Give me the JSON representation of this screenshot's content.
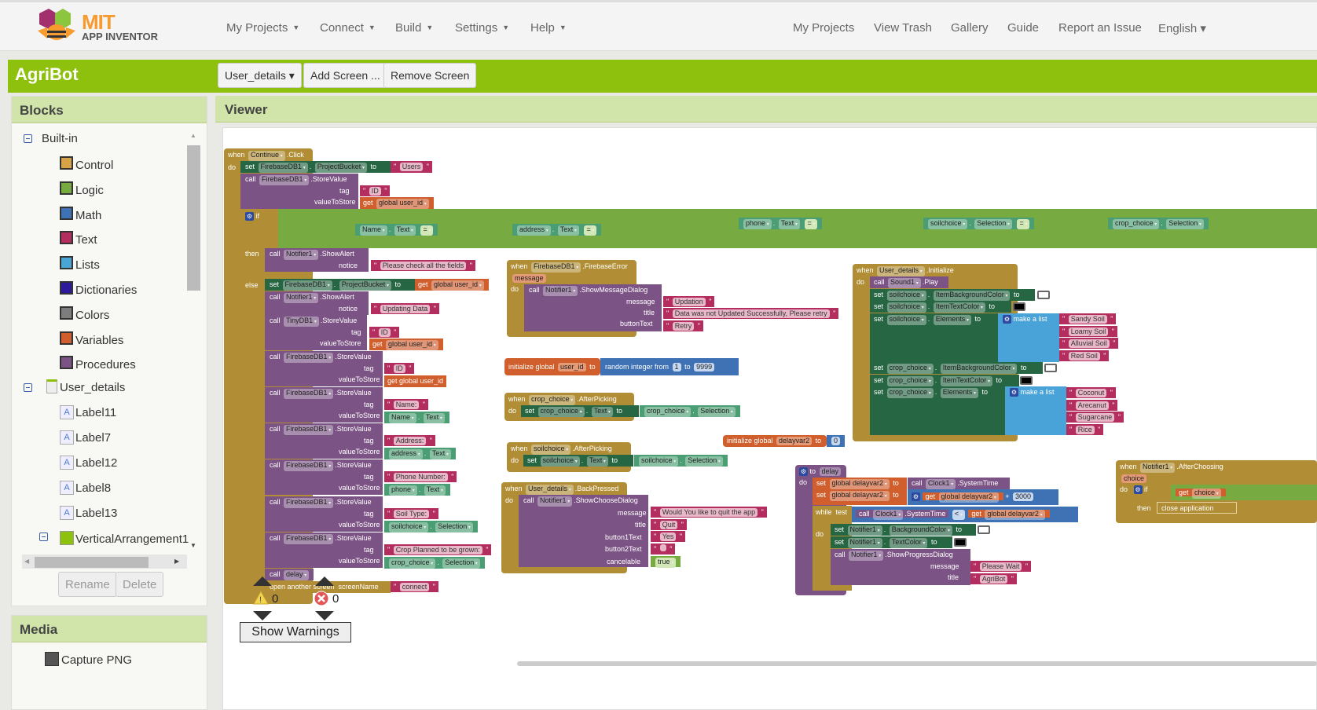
{
  "app": {
    "logo_title": "MIT",
    "logo_subtitle": "APP INVENTOR"
  },
  "top_menu": [
    {
      "label": "My Projects",
      "dropdown": true
    },
    {
      "label": "Connect",
      "dropdown": true
    },
    {
      "label": "Build",
      "dropdown": true
    },
    {
      "label": "Settings",
      "dropdown": true
    },
    {
      "label": "Help",
      "dropdown": true
    }
  ],
  "top_links": [
    "My Projects",
    "View Trash",
    "Gallery",
    "Guide",
    "Report an Issue",
    "English ▾"
  ],
  "project": {
    "name": "AgriBot",
    "screen_selector": "User_details ▾",
    "add_screen": "Add Screen ...",
    "remove_screen": "Remove Screen"
  },
  "blocks_panel": {
    "title": "Blocks",
    "builtin_label": "Built-in",
    "builtin": [
      {
        "label": "Control",
        "color": "#d8a347"
      },
      {
        "label": "Logic",
        "color": "#77ab41"
      },
      {
        "label": "Math",
        "color": "#3f71b5"
      },
      {
        "label": "Text",
        "color": "#b32d5e"
      },
      {
        "label": "Lists",
        "color": "#49a6d4"
      },
      {
        "label": "Dictionaries",
        "color": "#2d1a9a"
      },
      {
        "label": "Colors",
        "color": "#7d7d7d"
      },
      {
        "label": "Variables",
        "color": "#d05f2d"
      },
      {
        "label": "Procedures",
        "color": "#7c5385"
      }
    ],
    "screen_label": "User_details",
    "components": [
      "Label11",
      "Label7",
      "Label12",
      "Label8",
      "Label13"
    ],
    "arrangement": "VerticalArrangement1",
    "rename": "Rename",
    "delete": "Delete"
  },
  "media_panel": {
    "title": "Media",
    "items": [
      "Capture PNG"
    ]
  },
  "viewer": {
    "title": "Viewer"
  },
  "warnings": {
    "warning_count": "0",
    "error_count": "0",
    "show_warnings": "Show Warnings"
  },
  "blocks": {
    "continue_click": {
      "when": "when",
      "component": "Continue",
      "event": ".Click",
      "do": "do",
      "set1": {
        "component": "FirebaseDB1",
        "prop": "ProjectBucket",
        "value": "Users"
      },
      "store1": {
        "component": "FirebaseDB1",
        "method": ".StoreValue",
        "tag": "ID",
        "value": "global user_id"
      },
      "if_fields": [
        "Name",
        "address",
        "phone",
        "soilchoice",
        "crop_choice"
      ],
      "then_alert": {
        "component": "Notifier1",
        "method": ".ShowAlert",
        "notice": "Please check all the fields"
      },
      "else_set": {
        "component": "FirebaseDB1",
        "prop": "ProjectBucket",
        "value": "global user_id"
      },
      "else_alert": "Updating Data",
      "tinydb": {
        "component": "TinyDB1",
        "tag": "ID",
        "value": "global user_id"
      },
      "stores": [
        {
          "tag": "ID",
          "value": "get global user_id"
        },
        {
          "tag": "Name:",
          "comp": "Name",
          "prop": "Text"
        },
        {
          "tag": "Address:",
          "comp": "address",
          "prop": "Text"
        },
        {
          "tag": "Phone Number:",
          "comp": "phone",
          "prop": "Text"
        },
        {
          "tag": "Soil Type:",
          "comp": "soilchoice",
          "prop": "Selection"
        },
        {
          "tag": "Crop Planned to be grown:",
          "comp": "crop_choice",
          "prop": "Selection"
        }
      ],
      "call_delay": "delay",
      "open_screen": "connect"
    },
    "firebase_error": {
      "component": "FirebaseDB1",
      "event": ".FirebaseError",
      "param": "message",
      "method": ".ShowMessageDialog",
      "message": "Updation",
      "title": "Data was not Updated Successfully, Please retry",
      "buttonText": "Retry"
    },
    "init_user_id": {
      "name": "user_id",
      "from": "1",
      "to": "9999"
    },
    "crop_afterpicking": {
      "component": "crop_choice",
      "event": ".AfterPicking"
    },
    "soil_afterpicking": {
      "component": "soilchoice",
      "event": ".AfterPicking"
    },
    "init_delayvar": {
      "name": "delayvar2",
      "value": "0"
    },
    "back_pressed": {
      "component": "User_details",
      "event": ".BackPressed",
      "method": ".ShowChooseDialog",
      "message": "Would You like to quit the app",
      "title": "Quit",
      "button1Text": "Yes",
      "button2Text": "",
      "cancelable": "true"
    },
    "initialize": {
      "component": "User_details",
      "event": ".Initialize",
      "sound": "Sound1",
      "soils": [
        "Sandy Soil",
        "Loamy Soil",
        "Alluvial Soil",
        "Red Soil"
      ],
      "crops": [
        "Coconut",
        "Arecanut",
        "Sugarcane",
        "Rice"
      ]
    },
    "delay_proc": {
      "name": "delay",
      "var": "global delayvar2",
      "clock": "Clock1",
      "add": "3000",
      "message": "Please Wait",
      "title": "AgriBot"
    },
    "after_choosing": {
      "component": "Notifier1",
      "event": ".AfterChoosing",
      "param": "choice",
      "action": "close application"
    }
  }
}
